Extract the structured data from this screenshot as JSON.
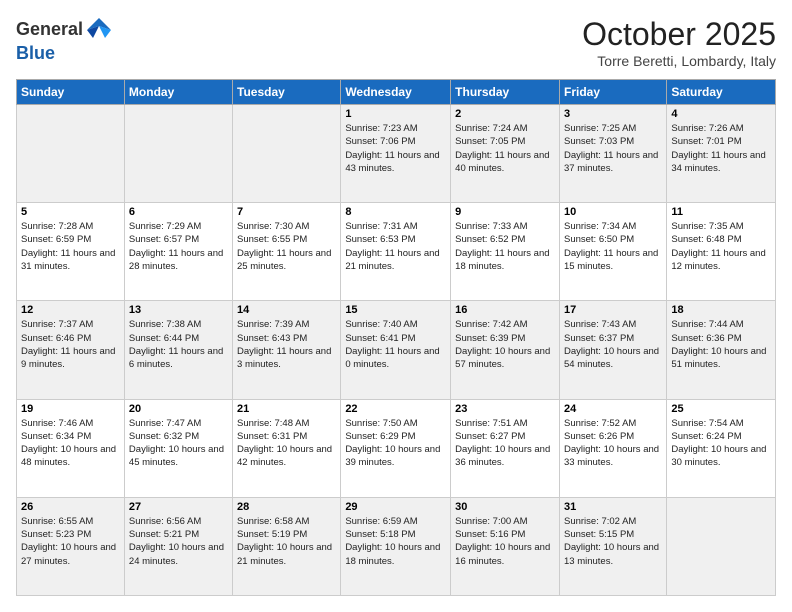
{
  "header": {
    "logo_line1": "General",
    "logo_line2": "Blue",
    "month_title": "October 2025",
    "location": "Torre Beretti, Lombardy, Italy"
  },
  "days_of_week": [
    "Sunday",
    "Monday",
    "Tuesday",
    "Wednesday",
    "Thursday",
    "Friday",
    "Saturday"
  ],
  "weeks": [
    [
      {
        "num": "",
        "sunrise": "",
        "sunset": "",
        "daylight": ""
      },
      {
        "num": "",
        "sunrise": "",
        "sunset": "",
        "daylight": ""
      },
      {
        "num": "",
        "sunrise": "",
        "sunset": "",
        "daylight": ""
      },
      {
        "num": "1",
        "sunrise": "Sunrise: 7:23 AM",
        "sunset": "Sunset: 7:06 PM",
        "daylight": "Daylight: 11 hours and 43 minutes."
      },
      {
        "num": "2",
        "sunrise": "Sunrise: 7:24 AM",
        "sunset": "Sunset: 7:05 PM",
        "daylight": "Daylight: 11 hours and 40 minutes."
      },
      {
        "num": "3",
        "sunrise": "Sunrise: 7:25 AM",
        "sunset": "Sunset: 7:03 PM",
        "daylight": "Daylight: 11 hours and 37 minutes."
      },
      {
        "num": "4",
        "sunrise": "Sunrise: 7:26 AM",
        "sunset": "Sunset: 7:01 PM",
        "daylight": "Daylight: 11 hours and 34 minutes."
      }
    ],
    [
      {
        "num": "5",
        "sunrise": "Sunrise: 7:28 AM",
        "sunset": "Sunset: 6:59 PM",
        "daylight": "Daylight: 11 hours and 31 minutes."
      },
      {
        "num": "6",
        "sunrise": "Sunrise: 7:29 AM",
        "sunset": "Sunset: 6:57 PM",
        "daylight": "Daylight: 11 hours and 28 minutes."
      },
      {
        "num": "7",
        "sunrise": "Sunrise: 7:30 AM",
        "sunset": "Sunset: 6:55 PM",
        "daylight": "Daylight: 11 hours and 25 minutes."
      },
      {
        "num": "8",
        "sunrise": "Sunrise: 7:31 AM",
        "sunset": "Sunset: 6:53 PM",
        "daylight": "Daylight: 11 hours and 21 minutes."
      },
      {
        "num": "9",
        "sunrise": "Sunrise: 7:33 AM",
        "sunset": "Sunset: 6:52 PM",
        "daylight": "Daylight: 11 hours and 18 minutes."
      },
      {
        "num": "10",
        "sunrise": "Sunrise: 7:34 AM",
        "sunset": "Sunset: 6:50 PM",
        "daylight": "Daylight: 11 hours and 15 minutes."
      },
      {
        "num": "11",
        "sunrise": "Sunrise: 7:35 AM",
        "sunset": "Sunset: 6:48 PM",
        "daylight": "Daylight: 11 hours and 12 minutes."
      }
    ],
    [
      {
        "num": "12",
        "sunrise": "Sunrise: 7:37 AM",
        "sunset": "Sunset: 6:46 PM",
        "daylight": "Daylight: 11 hours and 9 minutes."
      },
      {
        "num": "13",
        "sunrise": "Sunrise: 7:38 AM",
        "sunset": "Sunset: 6:44 PM",
        "daylight": "Daylight: 11 hours and 6 minutes."
      },
      {
        "num": "14",
        "sunrise": "Sunrise: 7:39 AM",
        "sunset": "Sunset: 6:43 PM",
        "daylight": "Daylight: 11 hours and 3 minutes."
      },
      {
        "num": "15",
        "sunrise": "Sunrise: 7:40 AM",
        "sunset": "Sunset: 6:41 PM",
        "daylight": "Daylight: 11 hours and 0 minutes."
      },
      {
        "num": "16",
        "sunrise": "Sunrise: 7:42 AM",
        "sunset": "Sunset: 6:39 PM",
        "daylight": "Daylight: 10 hours and 57 minutes."
      },
      {
        "num": "17",
        "sunrise": "Sunrise: 7:43 AM",
        "sunset": "Sunset: 6:37 PM",
        "daylight": "Daylight: 10 hours and 54 minutes."
      },
      {
        "num": "18",
        "sunrise": "Sunrise: 7:44 AM",
        "sunset": "Sunset: 6:36 PM",
        "daylight": "Daylight: 10 hours and 51 minutes."
      }
    ],
    [
      {
        "num": "19",
        "sunrise": "Sunrise: 7:46 AM",
        "sunset": "Sunset: 6:34 PM",
        "daylight": "Daylight: 10 hours and 48 minutes."
      },
      {
        "num": "20",
        "sunrise": "Sunrise: 7:47 AM",
        "sunset": "Sunset: 6:32 PM",
        "daylight": "Daylight: 10 hours and 45 minutes."
      },
      {
        "num": "21",
        "sunrise": "Sunrise: 7:48 AM",
        "sunset": "Sunset: 6:31 PM",
        "daylight": "Daylight: 10 hours and 42 minutes."
      },
      {
        "num": "22",
        "sunrise": "Sunrise: 7:50 AM",
        "sunset": "Sunset: 6:29 PM",
        "daylight": "Daylight: 10 hours and 39 minutes."
      },
      {
        "num": "23",
        "sunrise": "Sunrise: 7:51 AM",
        "sunset": "Sunset: 6:27 PM",
        "daylight": "Daylight: 10 hours and 36 minutes."
      },
      {
        "num": "24",
        "sunrise": "Sunrise: 7:52 AM",
        "sunset": "Sunset: 6:26 PM",
        "daylight": "Daylight: 10 hours and 33 minutes."
      },
      {
        "num": "25",
        "sunrise": "Sunrise: 7:54 AM",
        "sunset": "Sunset: 6:24 PM",
        "daylight": "Daylight: 10 hours and 30 minutes."
      }
    ],
    [
      {
        "num": "26",
        "sunrise": "Sunrise: 6:55 AM",
        "sunset": "Sunset: 5:23 PM",
        "daylight": "Daylight: 10 hours and 27 minutes."
      },
      {
        "num": "27",
        "sunrise": "Sunrise: 6:56 AM",
        "sunset": "Sunset: 5:21 PM",
        "daylight": "Daylight: 10 hours and 24 minutes."
      },
      {
        "num": "28",
        "sunrise": "Sunrise: 6:58 AM",
        "sunset": "Sunset: 5:19 PM",
        "daylight": "Daylight: 10 hours and 21 minutes."
      },
      {
        "num": "29",
        "sunrise": "Sunrise: 6:59 AM",
        "sunset": "Sunset: 5:18 PM",
        "daylight": "Daylight: 10 hours and 18 minutes."
      },
      {
        "num": "30",
        "sunrise": "Sunrise: 7:00 AM",
        "sunset": "Sunset: 5:16 PM",
        "daylight": "Daylight: 10 hours and 16 minutes."
      },
      {
        "num": "31",
        "sunrise": "Sunrise: 7:02 AM",
        "sunset": "Sunset: 5:15 PM",
        "daylight": "Daylight: 10 hours and 13 minutes."
      },
      {
        "num": "",
        "sunrise": "",
        "sunset": "",
        "daylight": ""
      }
    ]
  ]
}
